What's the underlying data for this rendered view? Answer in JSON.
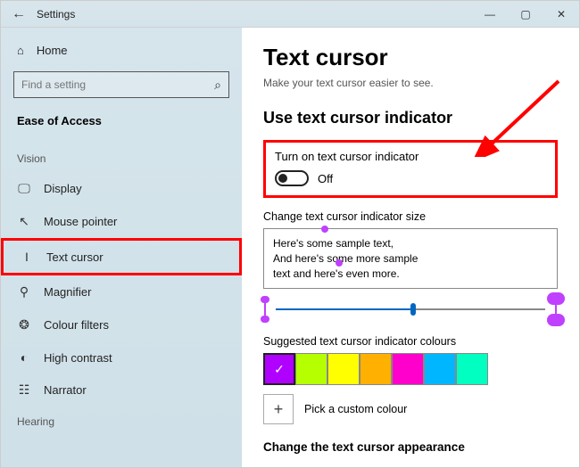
{
  "titlebar": {
    "app": "Settings"
  },
  "winbuttons": {
    "min": "—",
    "max": "▢",
    "close": "✕"
  },
  "sidebar": {
    "home": "Home",
    "search_placeholder": "Find a setting",
    "category": "Ease of Access",
    "groups": {
      "vision": "Vision",
      "hearing": "Hearing"
    },
    "items": [
      {
        "icon": "🖵",
        "label": "Display",
        "name": "sidebar-item-display"
      },
      {
        "icon": "↖",
        "label": "Mouse pointer",
        "name": "sidebar-item-mouse-pointer"
      },
      {
        "icon": "I",
        "label": "Text cursor",
        "name": "sidebar-item-text-cursor",
        "highlight": true
      },
      {
        "icon": "⚲",
        "label": "Magnifier",
        "name": "sidebar-item-magnifier"
      },
      {
        "icon": "❂",
        "label": "Colour filters",
        "name": "sidebar-item-colour-filters"
      },
      {
        "icon": "◐",
        "label": "High contrast",
        "name": "sidebar-item-high-contrast"
      },
      {
        "icon": "☷",
        "label": "Narrator",
        "name": "sidebar-item-narrator"
      }
    ]
  },
  "content": {
    "title": "Text cursor",
    "subtitle": "Make your text cursor easier to see.",
    "section1": "Use text cursor indicator",
    "toggle": {
      "label": "Turn on text cursor indicator",
      "state": "Off"
    },
    "size_label": "Change text cursor indicator size",
    "sample": {
      "l1": "Here's some sample text,",
      "l2": "And here's some more sample",
      "l3": "text and here's even more."
    },
    "colours_label": "Suggested text cursor indicator colours",
    "swatches": [
      "#b000ff",
      "#b6ff00",
      "#ffff00",
      "#ffb000",
      "#ff00cc",
      "#00b7ff",
      "#00ffc0"
    ],
    "selected_swatch": 0,
    "pick_label": "Pick a custom colour",
    "section2": "Change the text cursor appearance"
  }
}
